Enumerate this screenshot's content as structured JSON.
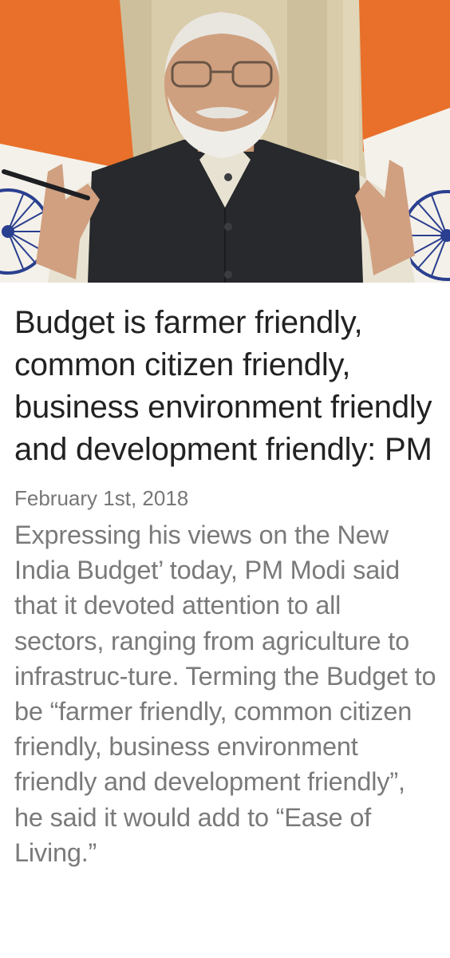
{
  "article": {
    "headline": "Budget is farmer friendly, common citizen friendly, business environment friendly and development friendly: PM",
    "date": "February 1st, 2018",
    "body": "Expressing his views on the New India Budget’ today, PM Modi said that it devoted attention to all sectors, ranging from agriculture to infrastruc-ture. Terming the Budget to be “farmer friendly, common citizen friendly, business environment friendly and development friendly”, he said it would add to “Ease of Living.”"
  },
  "colors": {
    "saffron": "#e8702a",
    "flag_white": "#f4f1ea",
    "chakra_blue": "#2a3f8f",
    "curtain": "#d9ccaa",
    "headline_text": "#222222",
    "body_text": "#7a7a7a"
  }
}
